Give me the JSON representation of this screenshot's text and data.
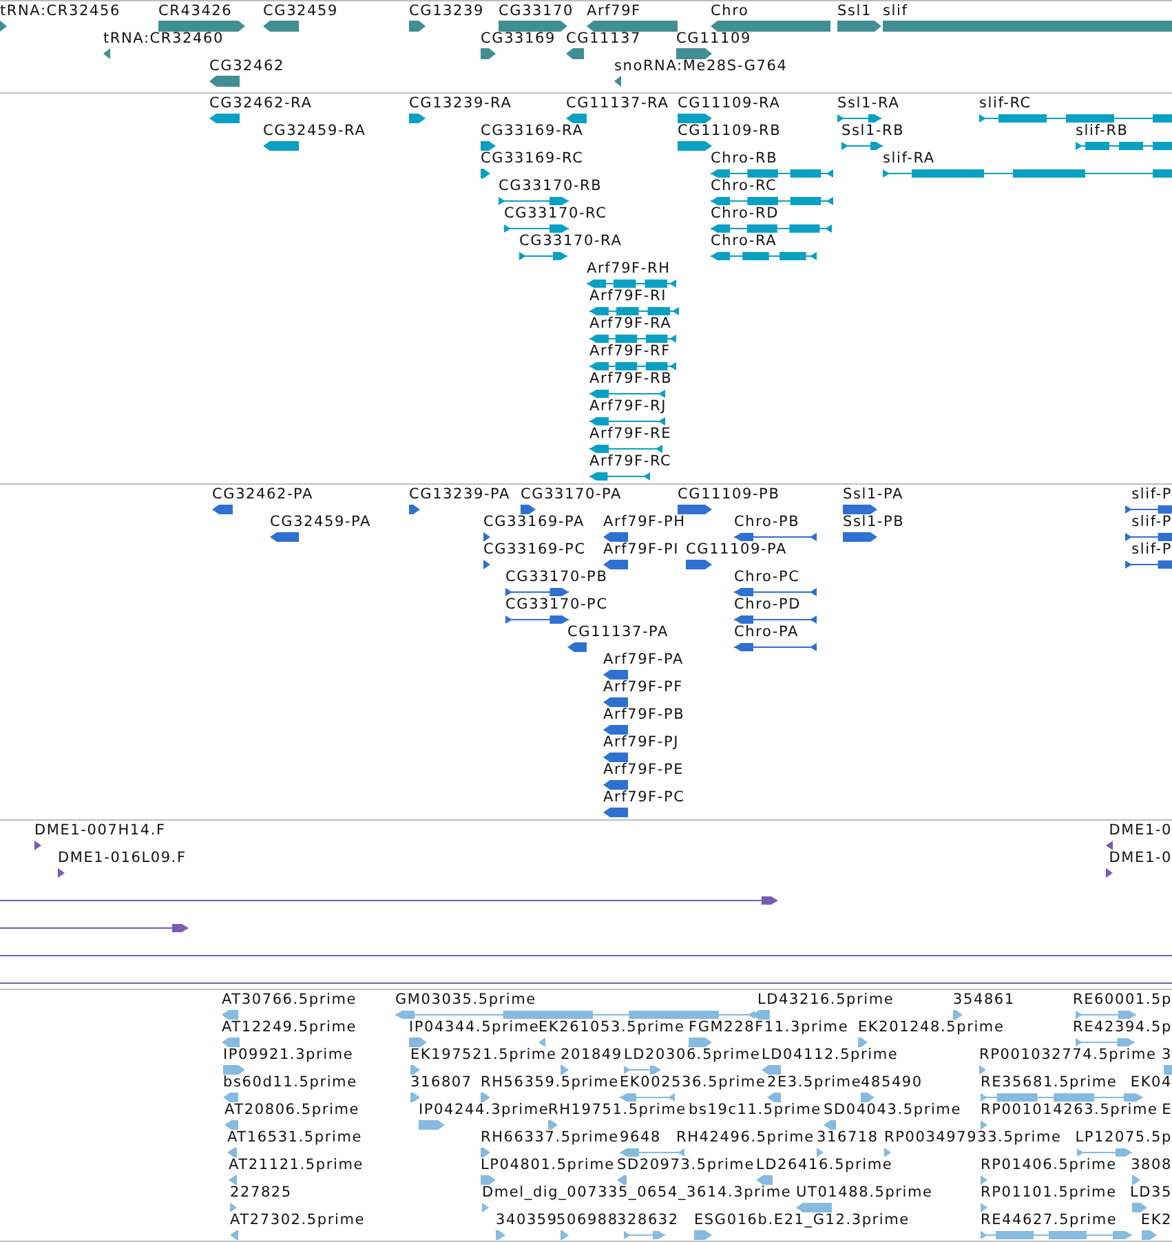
{
  "tracks": [
    {
      "kind": "gene",
      "color": "#418e93",
      "features": [
        {
          "label": "tRNA:CR32456",
          "reverse": false
        },
        {
          "label": "CR43426",
          "reverse": false
        },
        {
          "label": "CG32459",
          "reverse": true
        },
        {
          "label": "CG13239",
          "reverse": false
        },
        {
          "label": "CG33170",
          "reverse": false
        },
        {
          "label": "Arf79F",
          "reverse": true
        },
        {
          "label": "Chro",
          "reverse": true
        },
        {
          "label": "Ssl1",
          "reverse": false
        },
        {
          "label": "slif",
          "reverse": false
        },
        {
          "label": "tRNA:CR32460",
          "reverse": true
        },
        {
          "label": "CG33169",
          "reverse": false
        },
        {
          "label": "CG11137",
          "reverse": true
        },
        {
          "label": "CG11109",
          "reverse": false
        },
        {
          "label": "CG32462",
          "reverse": true
        },
        {
          "label": "snoRNA:Me28S-G764",
          "reverse": true
        }
      ]
    },
    {
      "kind": "mrna",
      "color": "#0aa0c4",
      "features": [
        {
          "label": "CG32462-RA",
          "reverse": true
        },
        {
          "label": "CG13239-RA",
          "reverse": false
        },
        {
          "label": "CG11137-RA",
          "reverse": true
        },
        {
          "label": "CG11109-RA",
          "reverse": false
        },
        {
          "label": "Ssl1-RA",
          "reverse": false
        },
        {
          "label": "slif-RC",
          "reverse": false
        },
        {
          "label": "CG32459-RA",
          "reverse": true
        },
        {
          "label": "CG33169-RA",
          "reverse": false
        },
        {
          "label": "CG11109-RB",
          "reverse": false
        },
        {
          "label": "Ssl1-RB",
          "reverse": false
        },
        {
          "label": "slif-RB",
          "reverse": false
        },
        {
          "label": "CG33169-RC",
          "reverse": false
        },
        {
          "label": "Chro-RB",
          "reverse": true
        },
        {
          "label": "slif-RA",
          "reverse": false
        },
        {
          "label": "CG33170-RB",
          "reverse": false
        },
        {
          "label": "Chro-RC",
          "reverse": true
        },
        {
          "label": "CG33170-RC",
          "reverse": false
        },
        {
          "label": "Chro-RD",
          "reverse": true
        },
        {
          "label": "CG33170-RA",
          "reverse": false
        },
        {
          "label": "Chro-RA",
          "reverse": true
        },
        {
          "label": "Arf79F-RH",
          "reverse": true
        },
        {
          "label": "Arf79F-RI",
          "reverse": true
        },
        {
          "label": "Arf79F-RA",
          "reverse": true
        },
        {
          "label": "Arf79F-RF",
          "reverse": true
        },
        {
          "label": "Arf79F-RB",
          "reverse": true
        },
        {
          "label": "Arf79F-RJ",
          "reverse": true
        },
        {
          "label": "Arf79F-RE",
          "reverse": true
        },
        {
          "label": "Arf79F-RC",
          "reverse": true
        }
      ]
    },
    {
      "kind": "protein",
      "color": "#3070d0",
      "features": [
        {
          "label": "CG32462-PA",
          "reverse": true
        },
        {
          "label": "CG13239-PA",
          "reverse": false
        },
        {
          "label": "CG33170-PA",
          "reverse": false
        },
        {
          "label": "CG11109-PB",
          "reverse": false
        },
        {
          "label": "Ssl1-PA",
          "reverse": false
        },
        {
          "label": "slif-P",
          "reverse": false
        },
        {
          "label": "CG32459-PA",
          "reverse": true
        },
        {
          "label": "CG33169-PA",
          "reverse": false
        },
        {
          "label": "Arf79F-PH",
          "reverse": true
        },
        {
          "label": "Chro-PB",
          "reverse": true
        },
        {
          "label": "Ssl1-PB",
          "reverse": false
        },
        {
          "label": "slif-P",
          "reverse": false
        },
        {
          "label": "CG33169-PC",
          "reverse": false
        },
        {
          "label": "Arf79F-PI",
          "reverse": true
        },
        {
          "label": "CG11109-PA",
          "reverse": false
        },
        {
          "label": "slif-P",
          "reverse": false
        },
        {
          "label": "CG33170-PB",
          "reverse": false
        },
        {
          "label": "Chro-PC",
          "reverse": true
        },
        {
          "label": "CG33170-PC",
          "reverse": false
        },
        {
          "label": "Chro-PD",
          "reverse": true
        },
        {
          "label": "CG11137-PA",
          "reverse": true
        },
        {
          "label": "Chro-PA",
          "reverse": true
        },
        {
          "label": "Arf79F-PA",
          "reverse": true
        },
        {
          "label": "Arf79F-PF",
          "reverse": true
        },
        {
          "label": "Arf79F-PB",
          "reverse": true
        },
        {
          "label": "Arf79F-PJ",
          "reverse": true
        },
        {
          "label": "Arf79F-PE",
          "reverse": true
        },
        {
          "label": "Arf79F-PC",
          "reverse": true
        }
      ]
    },
    {
      "kind": "est",
      "color": "#7a5cb0",
      "features": [
        {
          "kind": "read",
          "label": "DME1-007H14.F",
          "reverse": false
        },
        {
          "kind": "read",
          "label": "DME1-0",
          "reverse": true
        },
        {
          "kind": "read",
          "label": "DME1-016L09.F",
          "reverse": false
        },
        {
          "kind": "read",
          "label": "DME1-0",
          "reverse": false
        },
        {
          "kind": "read",
          "reverse": false
        },
        {
          "kind": "read",
          "reverse": false
        },
        {
          "kind": "span"
        },
        {
          "kind": "span"
        }
      ]
    },
    {
      "kind": "cdna",
      "color": "#86bbdf",
      "features": [
        {
          "label": "AT30766.5prime",
          "reverse": true
        },
        {
          "label": "GM03035.5prime",
          "reverse": true
        },
        {
          "label": "LD43216.5prime",
          "reverse": true
        },
        {
          "label": "354861",
          "reverse": false
        },
        {
          "label": "RE60001.5p",
          "reverse": false
        },
        {
          "label": "AT12249.5prime",
          "reverse": true
        },
        {
          "label": "IP04344.5prime",
          "reverse": false
        },
        {
          "label": "EK261053.5prime",
          "reverse": true
        },
        {
          "label": "FGM228F11.3prime",
          "reverse": false
        },
        {
          "label": "EK201248.5prime",
          "reverse": false
        },
        {
          "label": "RE42394.5p",
          "reverse": false
        },
        {
          "label": "IP09921.3prime",
          "reverse": false
        },
        {
          "label": "EK197521.5prime",
          "reverse": false
        },
        {
          "label": "201849",
          "reverse": false
        },
        {
          "label": "LD20306.5prime",
          "reverse": false
        },
        {
          "label": "LD04112.5prime",
          "reverse": true
        },
        {
          "label": "RP001032774.5prime",
          "reverse": false
        },
        {
          "label": "3",
          "reverse": false
        },
        {
          "label": "bs60d11.5prime",
          "reverse": true
        },
        {
          "label": "316807",
          "reverse": false
        },
        {
          "label": "RH56359.5prime",
          "reverse": false
        },
        {
          "label": "EK002536.5prime",
          "reverse": true
        },
        {
          "label": "2E3.5prime",
          "reverse": true
        },
        {
          "label": "485490",
          "reverse": false
        },
        {
          "label": "RE35681.5prime",
          "reverse": false
        },
        {
          "label": "EK04"
        },
        {
          "label": "AT20806.5prime",
          "reverse": true
        },
        {
          "label": "IP04244.3prime",
          "reverse": false
        },
        {
          "label": "RH19751.5prime",
          "reverse": false
        },
        {
          "label": "bs19c11.5prime"
        },
        {
          "label": "SD04043.5prime",
          "reverse": true
        },
        {
          "label": "RP001014263.5prime",
          "reverse": false
        },
        {
          "label": "E"
        },
        {
          "label": "AT16531.5prime",
          "reverse": true
        },
        {
          "label": "RH66337.5prime",
          "reverse": false
        },
        {
          "label": "9648",
          "reverse": true
        },
        {
          "label": "RH42496.5prime"
        },
        {
          "label": "316718",
          "reverse": false
        },
        {
          "label": "RP003497933.5prime",
          "reverse": false
        },
        {
          "label": "LP12075.5p",
          "reverse": false
        },
        {
          "label": "AT21121.5prime",
          "reverse": true
        },
        {
          "label": "LP04801.5prime",
          "reverse": false
        },
        {
          "label": "SD20973.5prime",
          "reverse": true
        },
        {
          "label": "LD26416.5prime",
          "reverse": true
        },
        {
          "label": "RP01406.5prime",
          "reverse": false
        },
        {
          "label": "3808",
          "reverse": false
        },
        {
          "label": "227825",
          "reverse": false
        },
        {
          "label": "Dmel_dig_007335_0654_3614.3prime",
          "reverse": false
        },
        {
          "label": "UT01488.5prime",
          "reverse": true
        },
        {
          "label": "RP01101.5prime",
          "reverse": false
        },
        {
          "label": "LD35",
          "reverse": false
        },
        {
          "label": "AT27302.5prime",
          "reverse": true
        },
        {
          "label": "340359",
          "reverse": false
        },
        {
          "label": "506988",
          "reverse": false
        },
        {
          "label": "328632",
          "reverse": false
        },
        {
          "label": "ESG016b.E21_G12.3prime",
          "reverse": false
        },
        {
          "label": "RE44627.5prime",
          "reverse": false
        },
        {
          "label": "EK2",
          "reverse": false
        }
      ]
    }
  ]
}
